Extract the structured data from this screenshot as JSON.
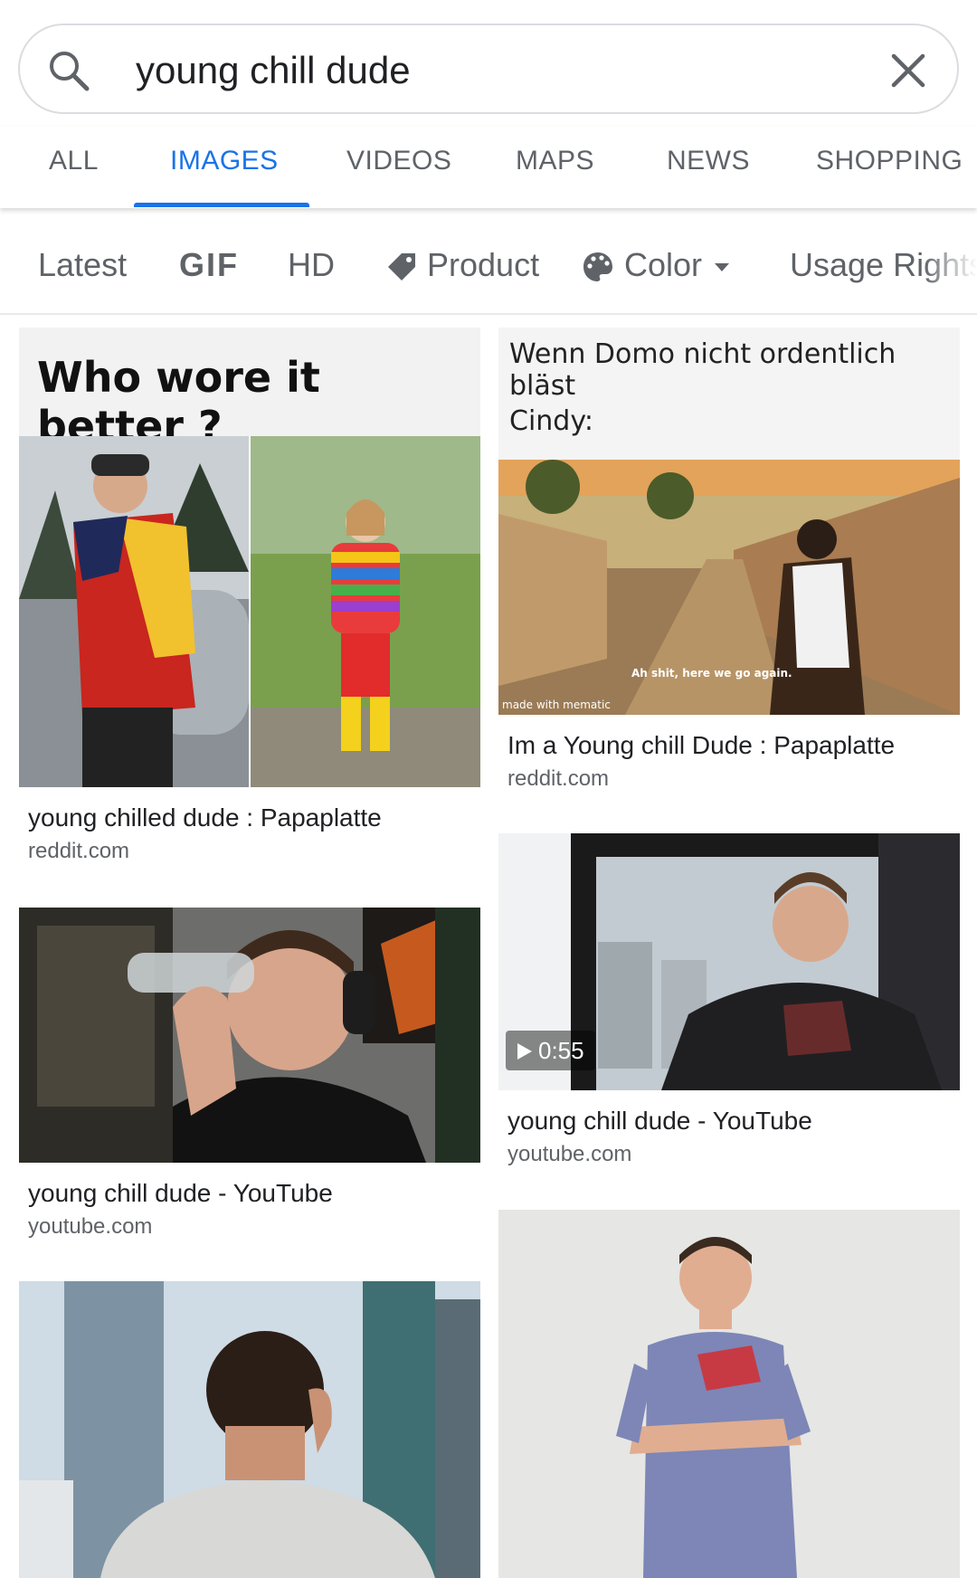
{
  "search": {
    "query": "young chill dude"
  },
  "tabs": [
    "ALL",
    "IMAGES",
    "VIDEOS",
    "MAPS",
    "NEWS",
    "SHOPPING"
  ],
  "filters": {
    "latest": "Latest",
    "gif": "GIF",
    "hd": "HD",
    "product": "Product",
    "color": "Color",
    "usage_rights": "Usage Rights"
  },
  "results": {
    "r1": {
      "image_text": "Who wore it better ?",
      "title": "young chilled dude : Papaplatte",
      "source": "reddit.com"
    },
    "r2": {
      "line1": "Wenn Domo nicht ordentlich bläst",
      "line2": "Cindy:",
      "subtitle": "Ah shit, here we go again.",
      "watermark": "made with mematic",
      "title": "Im a Young chill Dude : Papaplatte",
      "source": "reddit.com"
    },
    "r3": {
      "title": "young chill dude - YouTube",
      "source": "youtube.com"
    },
    "r4": {
      "duration": "0:55",
      "title": "young chill dude - YouTube",
      "source": "youtube.com"
    }
  },
  "colors": {
    "accent": "#1a73e8",
    "text": "#202124",
    "muted": "#5f6368"
  }
}
